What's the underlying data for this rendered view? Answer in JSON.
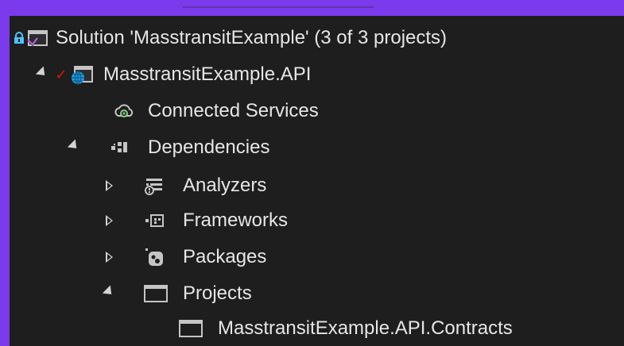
{
  "solution_explorer": {
    "solution": {
      "label": "Solution 'MasstransitExample' (3 of 3 projects)",
      "icon": "solution-icon",
      "lock_icon": "lock-icon"
    },
    "project": {
      "label": "MasstransitExample.API",
      "icon": "web-project-icon",
      "status_icon": "checkmark-icon",
      "status_color": "#e51400"
    },
    "nodes": [
      {
        "label": "Connected Services",
        "icon": "connected-services-icon"
      },
      {
        "label": "Dependencies",
        "icon": "dependencies-icon"
      },
      {
        "label": "Analyzers",
        "icon": "analyzers-icon"
      },
      {
        "label": "Frameworks",
        "icon": "frameworks-icon"
      },
      {
        "label": "Packages",
        "icon": "packages-icon"
      },
      {
        "label": "Projects",
        "icon": "projects-icon"
      },
      {
        "label": "MasstransitExample.API.Contracts",
        "icon": "project-reference-icon"
      }
    ]
  },
  "colors": {
    "background": "#1e1e1e",
    "frame": "#7c3aed",
    "text": "#e6e6e6"
  }
}
